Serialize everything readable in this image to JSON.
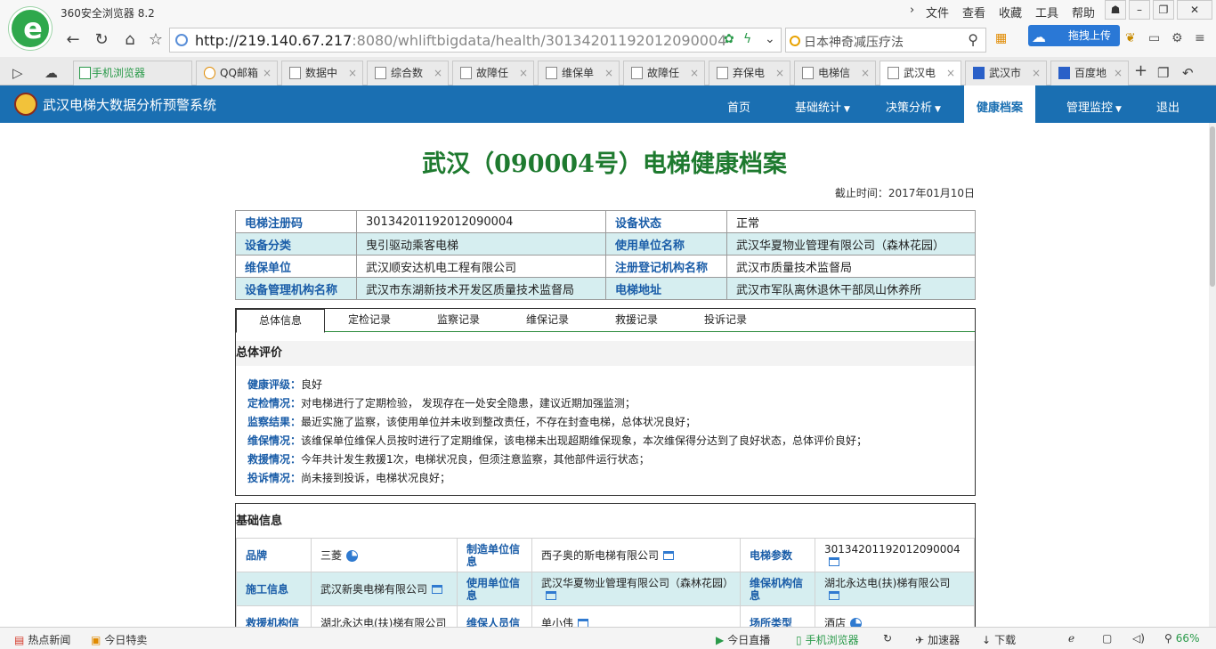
{
  "browser": {
    "app_title": "360安全浏览器 8.2",
    "menu": [
      "文件",
      "查看",
      "收藏",
      "工具",
      "帮助"
    ],
    "url_host": "http://219.140.67.217",
    "url_rest": ":8080/whliftbigdata/health/30134201192012090004",
    "search_text": "日本神奇减压疗法",
    "upload_label": "拖拽上传",
    "tabs": [
      {
        "label": "手机浏览器"
      },
      {
        "label": "QQ邮箱"
      },
      {
        "label": "数据中"
      },
      {
        "label": "综合数"
      },
      {
        "label": "故障任"
      },
      {
        "label": "维保单"
      },
      {
        "label": "故障任"
      },
      {
        "label": "弃保电"
      },
      {
        "label": "电梯信"
      },
      {
        "label": "武汉电"
      },
      {
        "label": "武汉市"
      },
      {
        "label": "百度地"
      }
    ]
  },
  "site": {
    "title": "武汉电梯大数据分析预警系统",
    "nav": [
      "首页",
      "基础统计",
      "决策分析",
      "健康档案",
      "管理监控",
      "退出"
    ]
  },
  "page": {
    "title": "武汉（090004号）电梯健康档案",
    "deadline": "截止时间：2017年01月10日",
    "info": [
      [
        "电梯注册码",
        "30134201192012090004",
        "设备状态",
        "正常"
      ],
      [
        "设备分类",
        "曳引驱动乘客电梯",
        "使用单位名称",
        "武汉华夏物业管理有限公司（森林花园）"
      ],
      [
        "维保单位",
        "武汉顺安达机电工程有限公司",
        "注册登记机构名称",
        "武汉市质量技术监督局"
      ],
      [
        "设备管理机构名称",
        "武汉市东湖新技术开发区质量技术监督局",
        "电梯地址",
        "武汉市军队离休退休干部凤山休养所"
      ]
    ],
    "panel_tabs": [
      "总体信息",
      "定检记录",
      "监察记录",
      "维保记录",
      "救援记录",
      "投诉记录"
    ],
    "overall_heading": "总体评价",
    "evaluation": [
      {
        "k": "健康评级：",
        "v": "良好"
      },
      {
        "k": "定检情况：",
        "v": "对电梯进行了定期检验， 发现存在一处安全隐患，建议近期加强监测；"
      },
      {
        "k": "监察结果：",
        "v": "最近实施了监察，该使用单位并未收到整改责任，不存在封查电梯，总体状况良好；"
      },
      {
        "k": "维保情况：",
        "v": "该维保单位维保人员按时进行了定期维保，该电梯未出现超期维保现象，本次维保得分达到了良好状态，总体评价良好；"
      },
      {
        "k": "救援情况：",
        "v": "今年共计发生救援1次，电梯状况良，但须注意监察，其他部件运行状态；"
      },
      {
        "k": "投诉情况：",
        "v": "尚未接到投诉，电梯状况良好；"
      }
    ],
    "basic_heading": "基础信息",
    "basic": [
      [
        "品牌",
        "三菱",
        "制造单位信息",
        "西子奥的斯电梯有限公司",
        "电梯参数",
        "30134201192012090004"
      ],
      [
        "施工信息",
        "武汉新奥电梯有限公司",
        "使用单位信息",
        "武汉华夏物业管理有限公司（森林花园）",
        "维保机构信息",
        "湖北永达电(扶)梯有限公司"
      ],
      [
        "救援机构信",
        "湖北永达电(扶)梯有限公司",
        "维保人员信",
        "单小伟",
        "场所类型",
        "酒店"
      ]
    ]
  },
  "statusbar": {
    "left": [
      "热点新闻",
      "今日特卖"
    ],
    "right": [
      "今日直播",
      "手机浏览器",
      "加速器",
      "下载",
      "66%"
    ]
  },
  "colors": {
    "nav_blue": "#1a6fb2",
    "title_green": "#1e7a2f",
    "label_blue": "#1a5da8",
    "row_tint": "#d6eef0"
  }
}
